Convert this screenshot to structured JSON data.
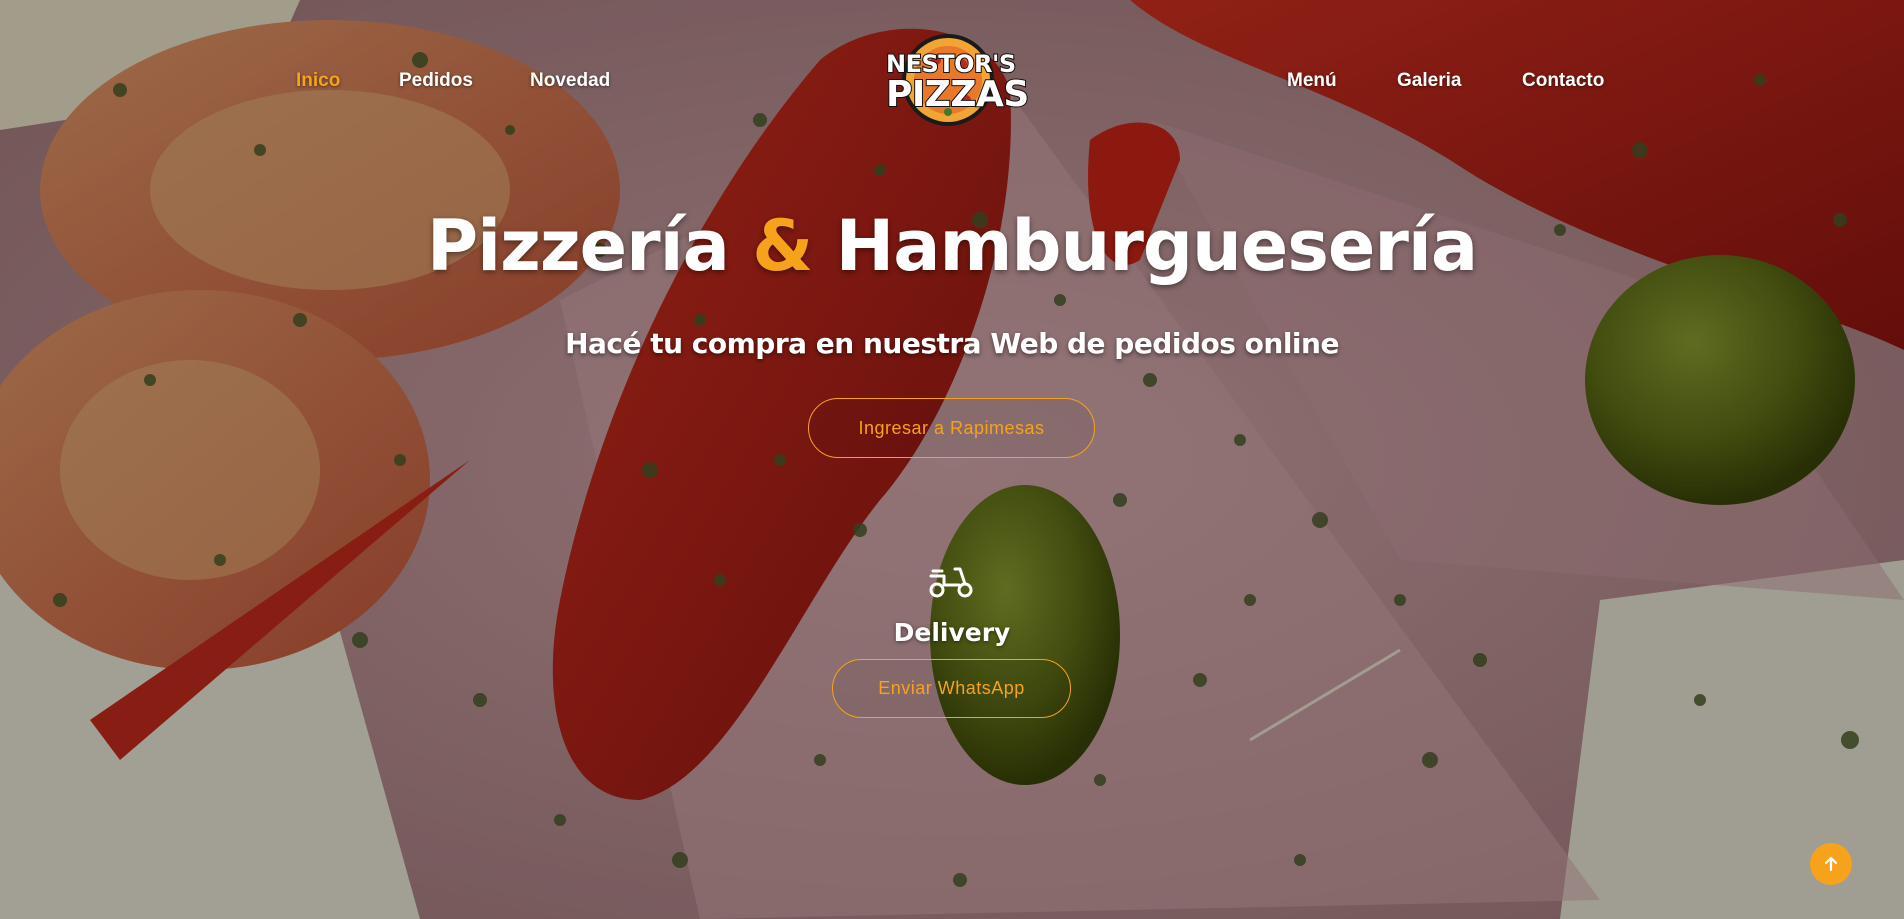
{
  "brand": {
    "logo_line1": "NESTOR'S",
    "logo_line2": "PIZZAS",
    "accent_color": "#f7a21b"
  },
  "nav": {
    "left_items": [
      {
        "label": "Inico",
        "active": true
      },
      {
        "label": "Pedidos",
        "active": false
      },
      {
        "label": "Novedad",
        "active": false
      }
    ],
    "right_items": [
      {
        "label": "Menú",
        "active": false
      },
      {
        "label": "Galeria",
        "active": false
      },
      {
        "label": "Contacto",
        "active": false
      }
    ]
  },
  "hero": {
    "title_part1": "Pizzería",
    "title_amp": "&",
    "title_part2": "Hamburguesería",
    "subtitle": "Hacé tu compra en nuestra Web de pedidos online",
    "cta_label": "Ingresar a Rapimesas"
  },
  "delivery": {
    "icon": "scooter-icon",
    "title": "Delivery",
    "button_label": "Enviar WhatsApp"
  },
  "back_to_top": {
    "icon": "arrow-up-icon"
  }
}
